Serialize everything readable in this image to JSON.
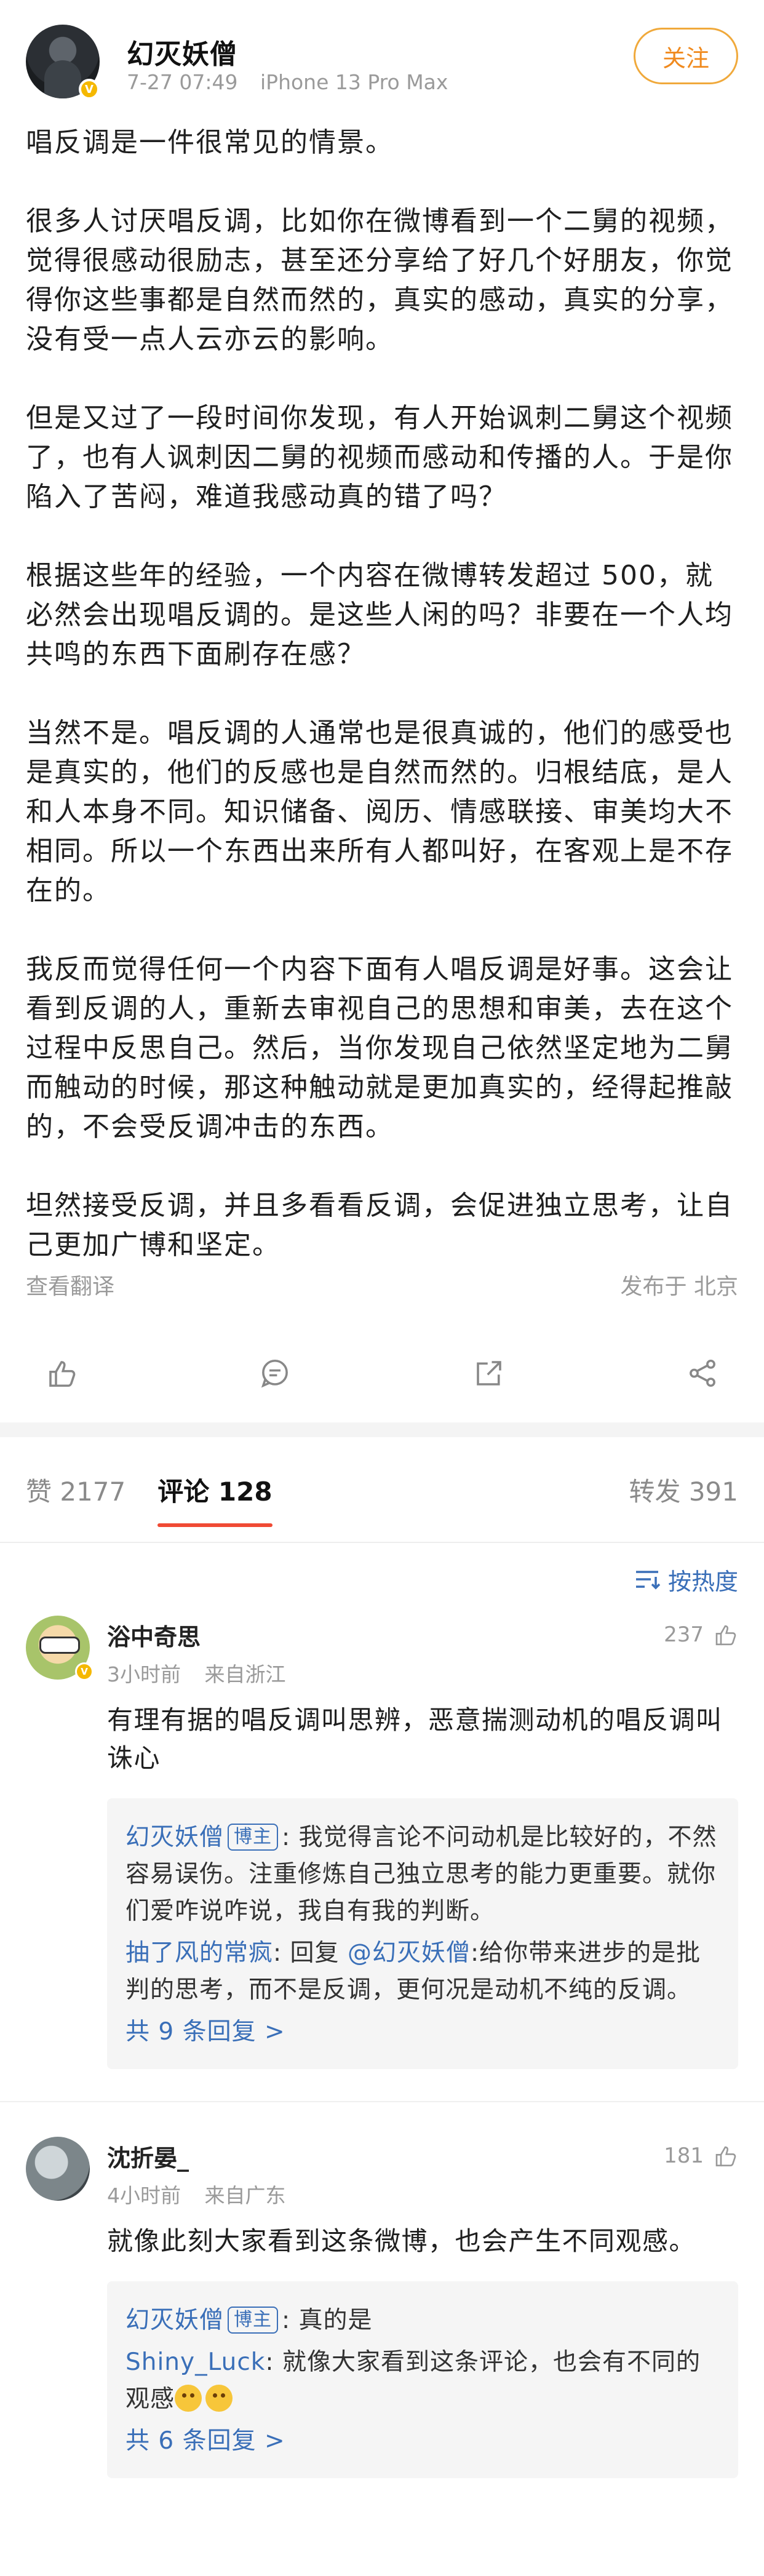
{
  "post": {
    "author": "幻灭妖僧",
    "time": "7-27 07:49",
    "device": "iPhone 13 Pro Max",
    "follow_label": "关注",
    "paragraphs": [
      "唱反调是一件很常见的情景。",
      "很多人讨厌唱反调，比如你在微博看到一个二舅的视频，觉得很感动很励志，甚至还分享给了好几个好朋友，你觉得你这些事都是自然而然的，真实的感动，真实的分享，没有受一点人云亦云的影响。",
      "但是又过了一段时间你发现，有人开始讽刺二舅这个视频了，也有人讽刺因二舅的视频而感动和传播的人。于是你陷入了苦闷，难道我感动真的错了吗？",
      "根据这些年的经验，一个内容在微博转发超过 500，就必然会出现唱反调的。是这些人闲的吗？非要在一个人均共鸣的东西下面刷存在感？",
      "当然不是。唱反调的人通常也是很真诚的，他们的感受也是真实的，他们的反感也是自然而然的。归根结底，是人和人本身不同。知识储备、阅历、情感联接、审美均大不相同。所以一个东西出来所有人都叫好，在客观上是不存在的。",
      "我反而觉得任何一个内容下面有人唱反调是好事。这会让看到反调的人，重新去审视自己的思想和审美，去在这个过程中反思自己。然后，当你发现自己依然坚定地为二舅而触动的时候，那这种触动就是更加真实的，经得起推敲的，不会受反调冲击的东西。",
      "坦然接受反调，并且多看看反调，会促进独立思考，让自己更加广博和坚定。"
    ],
    "translate_label": "查看翻译",
    "location_label": "发布于 北京"
  },
  "tabs": {
    "likes": "赞 2177",
    "comments": "评论 128",
    "reposts": "转发 391"
  },
  "sort_label": "按热度",
  "comments": [
    {
      "name": "浴中奇思",
      "time": "3小时前",
      "location": "来自浙江",
      "likes": "237",
      "text": "有理有据的唱反调叫思辨，恶意揣测动机的唱反调叫诛心",
      "reply1_name": "幻灭妖僧",
      "reply1_tag": "博主",
      "reply1_text": ": 我觉得言论不问动机是比较好的，不然容易误伤。注重修炼自己独立思考的能力更重要。就你们爱咋说咋说，我自有我的判断。",
      "reply2_name": "抽了风的常疯",
      "reply2_prefix": ": 回复 ",
      "reply2_at": "@幻灭妖僧",
      "reply2_text": ":给你带来进步的是批判的思考，而不是反调，更何况是动机不纯的反调。",
      "more": "共 9 条回复 >"
    },
    {
      "name": "沈折晏_",
      "time": "4小时前",
      "location": "来自广东",
      "likes": "181",
      "text": "就像此刻大家看到这条微博，也会产生不同观感。",
      "reply1_name": "幻灭妖僧",
      "reply1_tag": "博主",
      "reply1_text": ": 真的是",
      "reply2_name": "Shiny_Luck",
      "reply2_text": ": 就像大家看到这条评论，也会有不同的观感",
      "more": "共 6 条回复 >"
    }
  ],
  "icons": {
    "like": "thumbs-up-icon",
    "comment": "comment-bubble-icon",
    "repost": "repost-arrow-icon",
    "share": "share-nodes-icon",
    "sort": "sort-lines-icon",
    "verified": "verified-v-badge"
  },
  "colors": {
    "accent_orange": "#f08a1e",
    "link_blue": "#3a6fb8",
    "tab_indicator": "#f04a34",
    "verified_gold": "#f5b800"
  }
}
